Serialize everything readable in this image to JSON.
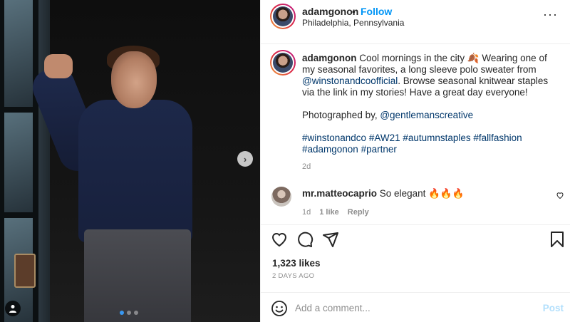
{
  "header": {
    "username": "adamgonon",
    "separator": "•",
    "follow_label": "Follow",
    "location": "Philadelphia, Pennsylvania",
    "more_icon": "more-horizontal-icon",
    "more_label": "···"
  },
  "caption": {
    "username": "adamgonon",
    "text_1": " Cool mornings in the city ",
    "emoji_1": "🍂",
    "text_2": " Wearing one of my seasonal favorites, a long sleeve polo sweater from ",
    "mention_brand": "@winstonandcoofficial",
    "text_3": ". Browse seasonal knitwear staples via the link in my stories! Have a great day everyone!",
    "photo_credit_prefix": "Photographed by, ",
    "mention_photographer": "@gentlemanscreative",
    "hashtags": "#winstonandco #AW21 #autumnstaples #fallfashion #adamgonon #partner",
    "time": "2d"
  },
  "comment": {
    "username": "mr.matteocaprio",
    "text": " So elegant ",
    "emoji": "🔥🔥🔥",
    "time": "1d",
    "likes": "1 like",
    "reply_label": "Reply"
  },
  "post": {
    "likes": "1,323 likes",
    "date": "2 DAYS AGO",
    "carousel_next": "›",
    "carousel_total": 3,
    "carousel_active": 1
  },
  "add_comment": {
    "placeholder": "Add a comment...",
    "post_label": "Post"
  },
  "colors": {
    "link": "#00376b",
    "follow": "#0095f6",
    "muted": "#8e8e8e",
    "post_disabled": "#b2dffc"
  }
}
